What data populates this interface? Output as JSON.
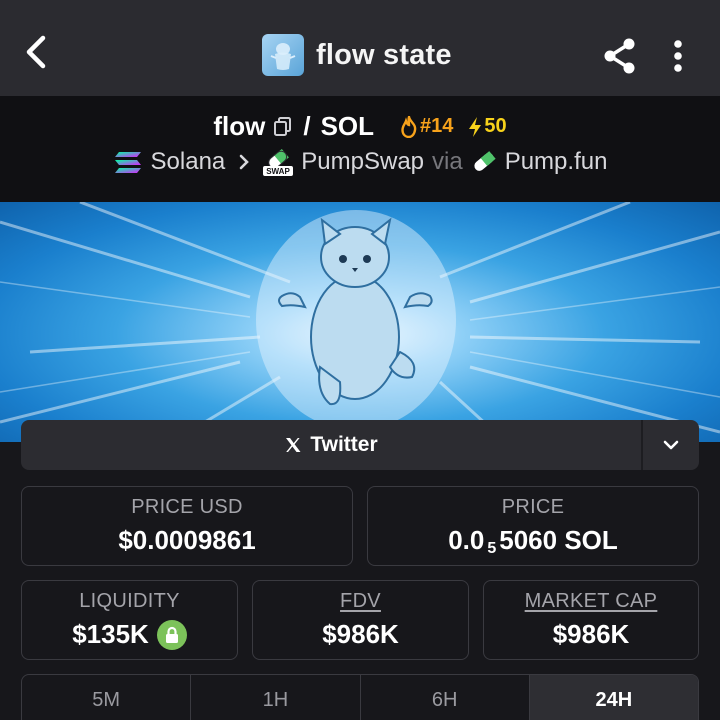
{
  "header": {
    "title": "flow state",
    "back_icon": "back-arrow-icon",
    "share_icon": "share-icon",
    "more_icon": "more-vertical-icon"
  },
  "pair": {
    "base": "flow",
    "separator": "/",
    "quote": "SOL",
    "rank": "#14",
    "boosts": "50",
    "rank_color": "#f7a21b",
    "boost_color": "#f7d21b"
  },
  "chain": {
    "chain_name": "Solana",
    "dex_name": "PumpSwap",
    "dex_badge": "SWAP",
    "via_label": "via",
    "launchpad": "Pump.fun"
  },
  "links": {
    "twitter_label": "Twitter",
    "twitter_icon": "x-logo-icon",
    "toggle_icon": "chevron-down-icon"
  },
  "stats": {
    "price_usd_label": "PRICE USD",
    "price_usd_value": "$0.0009861",
    "price_label": "PRICE",
    "price_prefix": "0.0",
    "price_zero_count": "5",
    "price_suffix": "5060 SOL",
    "liquidity_label": "LIQUIDITY",
    "liquidity_value": "$135K",
    "fdv_label": "FDV",
    "fdv_value": "$986K",
    "mcap_label": "MARKET CAP",
    "mcap_value": "$986K",
    "lock_color": "#7cc25a"
  },
  "timeframes": {
    "tabs": [
      "5M",
      "1H",
      "6H",
      "24H"
    ],
    "active": "24H"
  }
}
